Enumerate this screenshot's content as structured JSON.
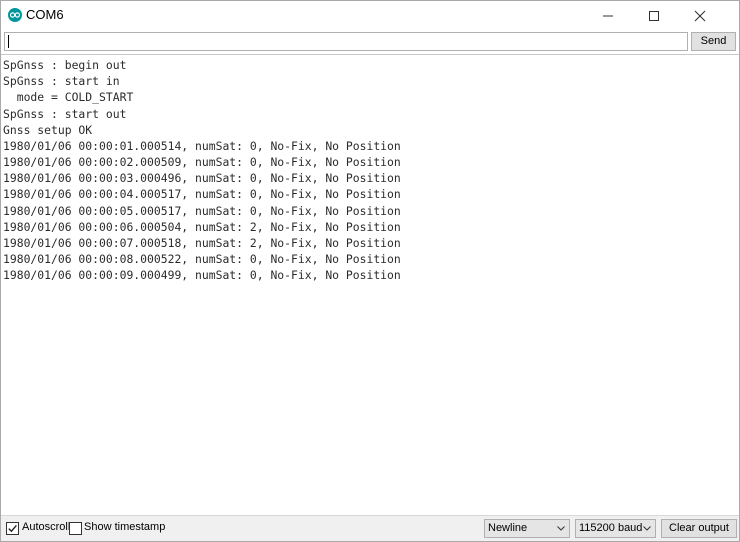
{
  "window": {
    "title": "COM6"
  },
  "send": {
    "input_value": "",
    "button_label": "Send"
  },
  "output": {
    "lines": [
      "SpGnss : begin out",
      "SpGnss : start in",
      "  mode = COLD_START",
      "SpGnss : start out",
      "Gnss setup OK",
      "1980/01/06 00:00:01.000514, numSat: 0, No-Fix, No Position",
      "1980/01/06 00:00:02.000509, numSat: 0, No-Fix, No Position",
      "1980/01/06 00:00:03.000496, numSat: 0, No-Fix, No Position",
      "1980/01/06 00:00:04.000517, numSat: 0, No-Fix, No Position",
      "1980/01/06 00:00:05.000517, numSat: 0, No-Fix, No Position",
      "1980/01/06 00:00:06.000504, numSat: 2, No-Fix, No Position",
      "1980/01/06 00:00:07.000518, numSat: 2, No-Fix, No Position",
      "1980/01/06 00:00:08.000522, numSat: 0, No-Fix, No Position",
      "1980/01/06 00:00:09.000499, numSat: 0, No-Fix, No Position"
    ]
  },
  "bottom": {
    "autoscroll_label": "Autoscroll",
    "autoscroll_checked": true,
    "timestamp_label": "Show timestamp",
    "timestamp_checked": false,
    "line_ending": "Newline",
    "baud": "115200 baud",
    "clear_label": "Clear output"
  },
  "icons": {
    "app": "arduino-icon",
    "minimize": "minimize-icon",
    "maximize": "maximize-icon",
    "close": "close-icon",
    "checkmark": "checkmark-icon",
    "dropdown": "chevron-down-icon"
  },
  "colors": {
    "accent": "#00979c"
  }
}
